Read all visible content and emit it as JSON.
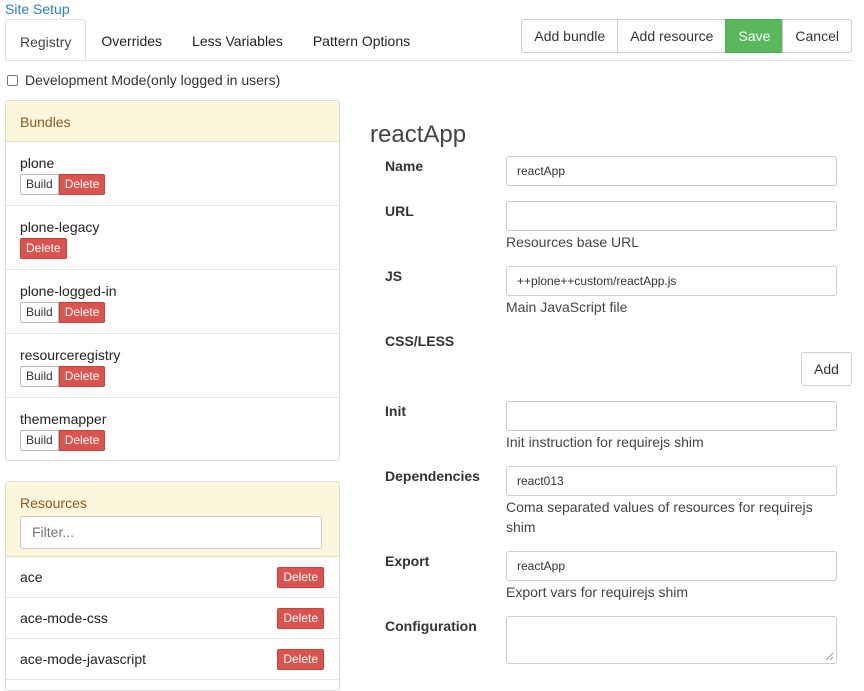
{
  "header": {
    "site_setup": "Site Setup"
  },
  "tabs": [
    {
      "label": "Registry",
      "active": true
    },
    {
      "label": "Overrides"
    },
    {
      "label": "Less Variables"
    },
    {
      "label": "Pattern Options"
    }
  ],
  "toolbar": {
    "add_bundle": "Add bundle",
    "add_resource": "Add resource",
    "save": "Save",
    "cancel": "Cancel"
  },
  "dev_mode": {
    "label": "Development Mode(only logged in users)",
    "checked": false
  },
  "bundles": {
    "title": "Bundles",
    "build_label": "Build",
    "delete_label": "Delete",
    "items": [
      {
        "name": "plone"
      },
      {
        "name": "plone-legacy"
      },
      {
        "name": "plone-logged-in"
      },
      {
        "name": "resourceregistry"
      },
      {
        "name": "thememapper"
      }
    ]
  },
  "resources": {
    "title": "Resources",
    "filter_placeholder": "Filter...",
    "delete_label": "Delete",
    "items": [
      {
        "name": "ace"
      },
      {
        "name": "ace-mode-css"
      },
      {
        "name": "ace-mode-javascript"
      }
    ]
  },
  "form": {
    "title": "reactApp",
    "name": {
      "label": "Name",
      "value": "reactApp"
    },
    "url": {
      "label": "URL",
      "value": "",
      "help": "Resources base URL"
    },
    "js": {
      "label": "JS",
      "value": "++plone++custom/reactApp.js",
      "help": "Main JavaScript file"
    },
    "css": {
      "label": "CSS/LESS",
      "add_label": "Add"
    },
    "init": {
      "label": "Init",
      "value": "",
      "help": "Init instruction for requirejs shim"
    },
    "dependencies": {
      "label": "Dependencies",
      "value": "react013",
      "help": "Coma separated values of resources for requirejs shim"
    },
    "export": {
      "label": "Export",
      "value": "reactApp",
      "help": "Export vars for requirejs shim"
    },
    "configuration": {
      "label": "Configuration",
      "value": ""
    }
  },
  "colors": {
    "accent_link": "#2f7fb8",
    "save": "#5bb75b",
    "danger": "#d9534f",
    "panel_header": "#fcf6dd"
  }
}
